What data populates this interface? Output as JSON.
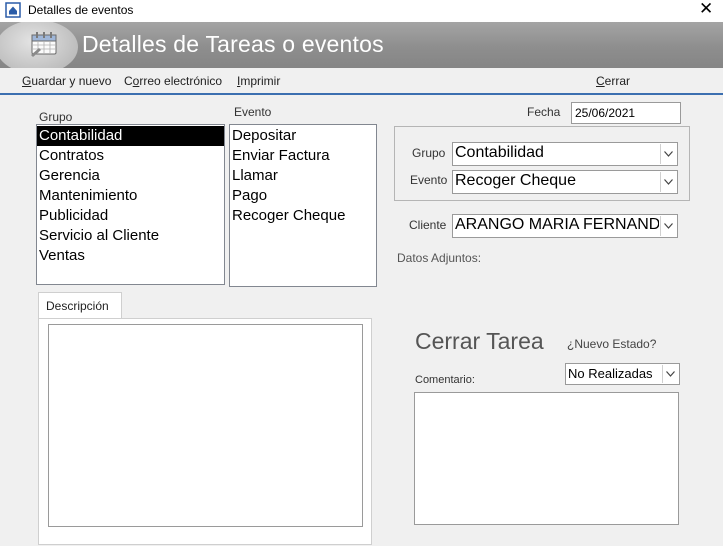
{
  "window": {
    "title": "Detalles de eventos",
    "close_glyph": "✕"
  },
  "header": {
    "title": "Detalles de Tareas o eventos",
    "icon": "calendar-icon"
  },
  "toolbar": {
    "save_new_label": "Guardar y nuevo",
    "email_label": "Correo electrónico",
    "print_label": "Imprimir",
    "close_label": "Cerrar"
  },
  "grupo_list": {
    "label": "Grupo",
    "items": [
      "Contabilidad",
      "Contratos",
      "Gerencia",
      "Mantenimiento",
      "Publicidad",
      "Servicio al Cliente",
      "Ventas"
    ],
    "selected": "Contabilidad"
  },
  "evento_list": {
    "label": "Evento",
    "items": [
      "Depositar",
      "Enviar Factura",
      "Llamar",
      "Pago",
      "Recoger Cheque"
    ]
  },
  "fecha": {
    "label": "Fecha",
    "value": "25/06/2021"
  },
  "selection": {
    "grupo_label": "Grupo",
    "grupo_value": "Contabilidad",
    "evento_label": "Evento",
    "evento_value": "Recoger Cheque"
  },
  "cliente": {
    "label": "Cliente",
    "value": "ARANGO  MARIA FERNAND."
  },
  "adjuntos": {
    "label": "Datos Adjuntos:"
  },
  "descripcion": {
    "tab_label": "Descripción",
    "value": ""
  },
  "cerrar_tarea": {
    "title": "Cerrar Tarea",
    "nuevo_estado_label": "¿Nuevo Estado?",
    "estado_value": "No Realizadas",
    "comentario_label": "Comentario:",
    "comentario_value": ""
  },
  "colors": {
    "header_bg": "#8e8e8e",
    "accent_line": "#3c6fb0",
    "selected_bg": "#000000"
  }
}
